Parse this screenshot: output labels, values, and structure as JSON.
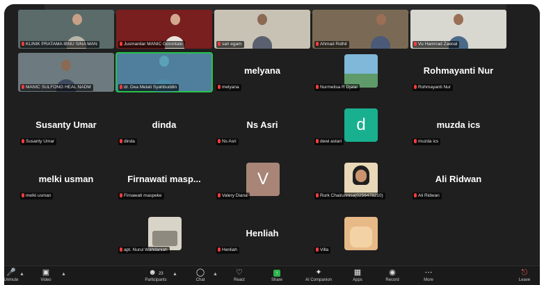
{
  "tiles": [
    {
      "label": "KLINIK PRATAMA IBNU SINA MAN",
      "video": true
    },
    {
      "label": "Jusmanilar MANIC Gorontalo",
      "video": true
    },
    {
      "label": "sari egam",
      "video": true
    },
    {
      "label": "Ahmad Ridhil",
      "video": true
    },
    {
      "label": "Vu Hamrrad Zaenal",
      "video": true
    },
    {
      "label": "MANIC SULFONG HEAL NADM",
      "video": true
    },
    {
      "label": "dr. Dea Melati Syahbuddin",
      "video": true,
      "active": true
    },
    {
      "name": "melyana",
      "label": "melyana"
    },
    {
      "label": "Nurmelisa R Djalal",
      "photo": true
    },
    {
      "name": "Rohmayanti Nur",
      "label": "Rohmayanti Nur"
    },
    {
      "name": "Susanty Umar",
      "label": "Susanty Umar"
    },
    {
      "name": "dinda",
      "label": "dinda"
    },
    {
      "name": "Ns Asri",
      "label": "Ns Asri"
    },
    {
      "label": "dewi astari",
      "avatar": "d",
      "avatar_color": "#19b08f"
    },
    {
      "name": "muzda ics",
      "label": "muzda ics"
    },
    {
      "name": "melki usman",
      "label": "melki usman"
    },
    {
      "name": "Firnawati masp...",
      "label": "Firnawati maspeke"
    },
    {
      "label": "Valery Diana",
      "avatar": "V",
      "avatar_color": "#a88577"
    },
    {
      "label": "Rurk Chairunnisa(0256478210)",
      "photo": true
    },
    {
      "name": "Ali Ridwan",
      "label": "Ali Ridwan"
    },
    {
      "label": "apt. Nurul Wahdaniah",
      "photo": true
    },
    {
      "name": "Henliah",
      "label": "Henliah"
    },
    {
      "label": "Villa",
      "photo": true
    }
  ],
  "toolbar": {
    "unmute": "Unmute",
    "video": "Video",
    "participants": "Participants",
    "participants_count": "23",
    "chat": "Chat",
    "react": "React",
    "share": "Share",
    "ai_companion": "AI Companion",
    "apps": "Apps",
    "record": "Record",
    "more": "More",
    "leave": "Leave"
  }
}
